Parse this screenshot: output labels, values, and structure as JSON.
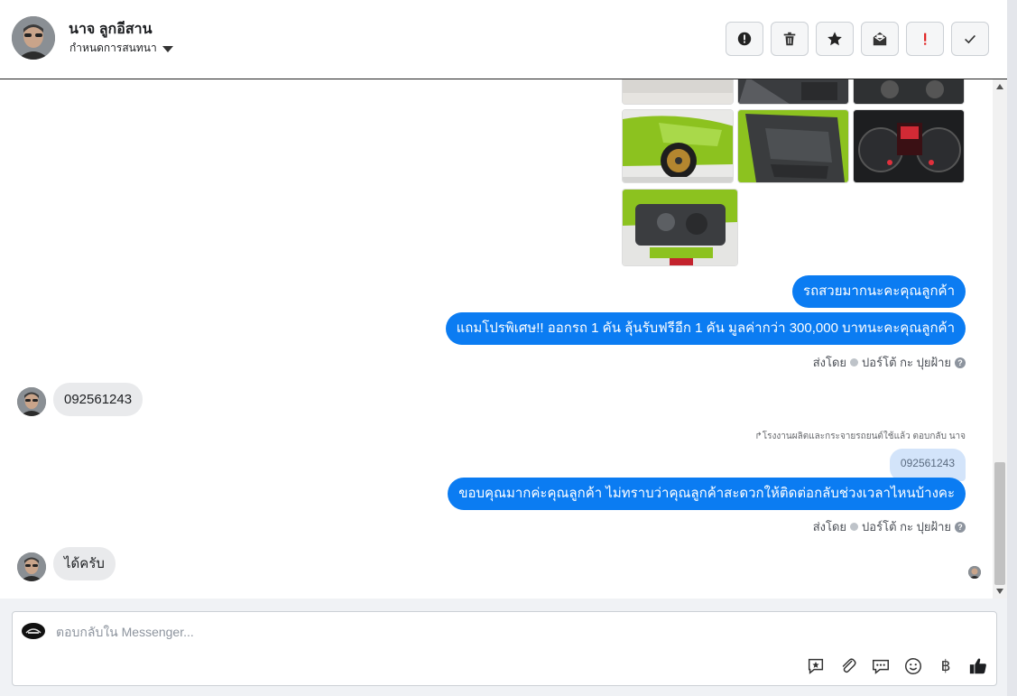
{
  "header": {
    "name": "นาจ ลูกอีสาน",
    "subtitle": "กำหนดการสนทนา",
    "actions": [
      {
        "name": "spam-action-button",
        "icon": "alert-circle-icon"
      },
      {
        "name": "delete-action-button",
        "icon": "trash-icon"
      },
      {
        "name": "star-action-button",
        "icon": "star-icon"
      },
      {
        "name": "unread-action-button",
        "icon": "mail-icon"
      },
      {
        "name": "important-action-button",
        "icon": "exclamation-icon"
      },
      {
        "name": "done-action-button",
        "icon": "check-icon"
      }
    ]
  },
  "messages": {
    "out_1": "รถสวยมากนะคะคุณลูกค้า",
    "out_2": "แถมโปรพิเศษ!! ออกรถ 1 คัน ลุ้นรับฟรีอีก 1 คัน มูลค่ากว่า 300,000 บาทนะคะคุณลูกค้า",
    "sent_by_label": "ส่งโดย",
    "sent_by_name": "ปอร์โต้ กะ ปุยฝ้าย",
    "in_1": "092561243",
    "reply_note": "โรงงานผลิตและกระจายรถยนต์ใช้แล้ว ตอบกลับ นาจ",
    "quoted_text": "092561243",
    "out_3": "ขอบคุณมากค่ะคุณลูกค้า ไม่ทราบว่าคุณลูกค้าสะดวกให้ติดต่อกลับช่วงเวลาไหนบ้างคะ",
    "in_2": "ได้ครับ"
  },
  "composer": {
    "placeholder": "ตอบกลับใน Messenger...",
    "tools": [
      "saved-reply-icon",
      "attachment-icon",
      "chat-bubbles-icon",
      "emoji-icon",
      "baht-icon",
      "thumbs-up-icon"
    ],
    "baht_glyph": "฿"
  },
  "colors": {
    "outgoing_bubble": "#0b7cf2",
    "incoming_bubble": "#e9eaec",
    "quoted_bubble": "#d3e4fa"
  }
}
